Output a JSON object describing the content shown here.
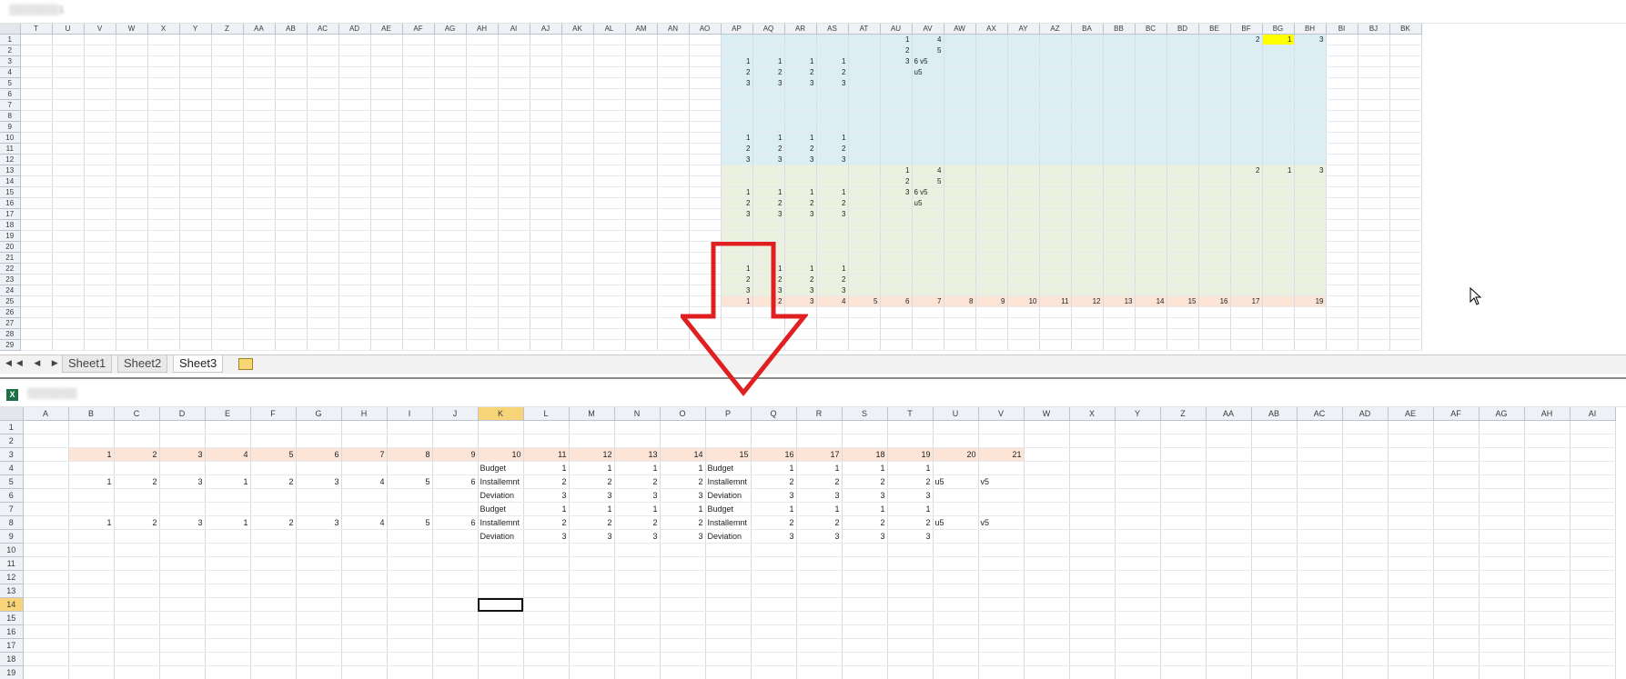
{
  "top_window": {
    "title": "▒▒▒▒▒▒▒1",
    "columns": [
      "T",
      "U",
      "V",
      "W",
      "X",
      "Y",
      "Z",
      "AA",
      "AB",
      "AC",
      "AD",
      "AE",
      "AF",
      "AG",
      "AH",
      "AI",
      "AJ",
      "AK",
      "AL",
      "AM",
      "AN",
      "AO",
      "AP",
      "AQ",
      "AR",
      "AS",
      "AT",
      "AU",
      "AV",
      "AW",
      "AX",
      "AY",
      "AZ",
      "BA",
      "BB",
      "BC",
      "BD",
      "BE",
      "BF",
      "BG",
      "BH",
      "BI",
      "BJ",
      "BK"
    ],
    "rows": [
      "1",
      "2",
      "3",
      "4",
      "5",
      "6",
      "7",
      "8",
      "9",
      "10",
      "11",
      "12",
      "13",
      "14",
      "15",
      "16",
      "17",
      "18",
      "19",
      "20",
      "21",
      "22",
      "23",
      "24",
      "25",
      "26",
      "27",
      "28",
      "29"
    ],
    "cells": {
      "r1": {
        "AU": "1",
        "AV": "4",
        "BF": "2",
        "BG": "1",
        "BH": "3"
      },
      "r2": {
        "AU": "2",
        "AV": "5"
      },
      "r3": {
        "AP": "1",
        "AQ": "1",
        "AR": "1",
        "AS": "1",
        "AU": "3",
        "AV": "6 v5"
      },
      "r4": {
        "AP": "2",
        "AQ": "2",
        "AR": "2",
        "AS": "2",
        "AV": "u5"
      },
      "r5": {
        "AP": "3",
        "AQ": "3",
        "AR": "3",
        "AS": "3"
      },
      "r10": {
        "AP": "1",
        "AQ": "1",
        "AR": "1",
        "AS": "1"
      },
      "r11": {
        "AP": "2",
        "AQ": "2",
        "AR": "2",
        "AS": "2"
      },
      "r12": {
        "AP": "3",
        "AQ": "3",
        "AR": "3",
        "AS": "3"
      },
      "r13": {
        "AU": "1",
        "AV": "4",
        "BF": "2",
        "BG": "1",
        "BH": "3"
      },
      "r14": {
        "AU": "2",
        "AV": "5"
      },
      "r15": {
        "AP": "1",
        "AQ": "1",
        "AR": "1",
        "AS": "1",
        "AU": "3",
        "AV": "6 v5"
      },
      "r16": {
        "AP": "2",
        "AQ": "2",
        "AR": "2",
        "AS": "2",
        "AV": "u5"
      },
      "r17": {
        "AP": "3",
        "AQ": "3",
        "AR": "3",
        "AS": "3"
      },
      "r22": {
        "AP": "1",
        "AQ": "1",
        "AR": "1",
        "AS": "1"
      },
      "r23": {
        "AP": "2",
        "AQ": "2",
        "AR": "2",
        "AS": "2"
      },
      "r24": {
        "AP": "3",
        "AQ": "3",
        "AR": "3",
        "AS": "3"
      },
      "r25": {
        "AP": "1",
        "AQ": "2",
        "AR": "3",
        "AS": "4",
        "AT": "5",
        "AU": "6",
        "AV": "7",
        "AW": "8",
        "AX": "9",
        "AY": "10",
        "AZ": "11",
        "BA": "12",
        "BB": "13",
        "BC": "14",
        "BD": "15",
        "BE": "16",
        "BF": "17",
        "BH": "19"
      }
    },
    "sheet_tabs": [
      "Sheet1",
      "Sheet2",
      "Sheet3"
    ],
    "active_tab": "Sheet3",
    "nav_buttons": "◀◀ ◀ ▶ ▶▶"
  },
  "bottom_window": {
    "title": "▒▒▒▒▒▒▒",
    "columns": [
      "A",
      "B",
      "C",
      "D",
      "E",
      "F",
      "G",
      "H",
      "I",
      "J",
      "K",
      "L",
      "M",
      "N",
      "O",
      "P",
      "Q",
      "R",
      "S",
      "T",
      "U",
      "V",
      "W",
      "X",
      "Y",
      "Z",
      "AA",
      "AB",
      "AC",
      "AD",
      "AE",
      "AF",
      "AG",
      "AH",
      "AI"
    ],
    "rows": [
      "1",
      "2",
      "3",
      "4",
      "5",
      "6",
      "7",
      "8",
      "9",
      "10",
      "11",
      "12",
      "13",
      "14",
      "15",
      "16",
      "17",
      "18",
      "19"
    ],
    "selected_column": "K",
    "selected_row": "14",
    "cells": {
      "r3": {
        "B": "1",
        "C": "2",
        "D": "3",
        "E": "4",
        "F": "5",
        "G": "6",
        "H": "7",
        "I": "8",
        "J": "9",
        "K": "10",
        "L": "11",
        "M": "12",
        "N": "13",
        "O": "14",
        "P": "15",
        "Q": "16",
        "R": "17",
        "S": "18",
        "T": "19",
        "U": "20",
        "V": "21"
      },
      "r4": {
        "K": "Budget",
        "L": "1",
        "M": "1",
        "N": "1",
        "O": "1",
        "P": "Budget",
        "Q": "1",
        "R": "1",
        "S": "1",
        "T": "1"
      },
      "r5": {
        "B": "1",
        "C": "2",
        "D": "3",
        "E": "1",
        "F": "2",
        "G": "3",
        "H": "4",
        "I": "5",
        "J": "6",
        "K": "Installemnt",
        "L": "2",
        "M": "2",
        "N": "2",
        "O": "2",
        "P": "Installemnt",
        "Q": "2",
        "R": "2",
        "S": "2",
        "T": "2",
        "U": "u5",
        "V": "v5"
      },
      "r6": {
        "K": "Deviation",
        "L": "3",
        "M": "3",
        "N": "3",
        "O": "3",
        "P": "Deviation",
        "Q": "3",
        "R": "3",
        "S": "3",
        "T": "3"
      },
      "r7": {
        "K": "Budget",
        "L": "1",
        "M": "1",
        "N": "1",
        "O": "1",
        "P": "Budget",
        "Q": "1",
        "R": "1",
        "S": "1",
        "T": "1"
      },
      "r8": {
        "B": "1",
        "C": "2",
        "D": "3",
        "E": "1",
        "F": "2",
        "G": "3",
        "H": "4",
        "I": "5",
        "J": "6",
        "K": "Installemnt",
        "L": "2",
        "M": "2",
        "N": "2",
        "O": "2",
        "P": "Installemnt",
        "Q": "2",
        "R": "2",
        "S": "2",
        "T": "2",
        "U": "u5",
        "V": "v5"
      },
      "r9": {
        "K": "Deviation",
        "L": "3",
        "M": "3",
        "N": "3",
        "O": "3",
        "P": "Deviation",
        "Q": "3",
        "R": "3",
        "S": "3",
        "T": "3"
      }
    }
  },
  "colors": {
    "blue_fill": "#dbeef4",
    "green_fill": "#ebf1de",
    "peach_fill": "#fce4d6",
    "highlight": "#ffff00",
    "arrow": "#e02020"
  },
  "icons": {
    "excel": "excel-icon",
    "arrow": "down-arrow-icon",
    "cursor": "mouse-cursor-icon",
    "insert_sheet": "insert-sheet-icon"
  }
}
